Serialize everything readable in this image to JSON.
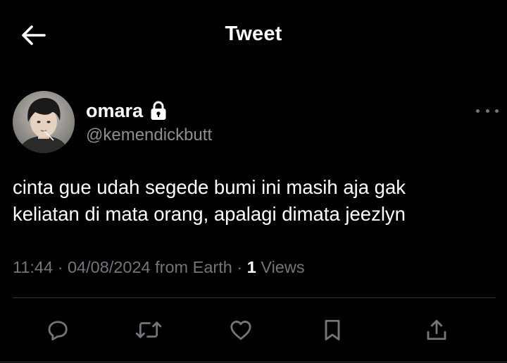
{
  "header": {
    "title": "Tweet",
    "back_icon": "arrow-left-icon"
  },
  "tweet": {
    "author": {
      "display_name": "omara",
      "handle": "@kemendickbutt",
      "protected_icon": "lock-icon"
    },
    "text_line1": "cinta gue udah segede bumi ini masih aja gak",
    "text_line2": "keliatan di mata orang, apalagi dimata jeezlyn",
    "meta": {
      "time": "11:44",
      "sep1": " · ",
      "date": "04/08/2024",
      "source": " from Earth",
      "sep2": " · ",
      "views_count": "1",
      "views_label": " Views"
    },
    "more_icon": "more-horizontal-icon"
  },
  "actions": [
    {
      "icon": "reply-icon"
    },
    {
      "icon": "retweet-icon"
    },
    {
      "icon": "heart-icon"
    },
    {
      "icon": "bookmark-icon"
    },
    {
      "icon": "share-icon"
    }
  ],
  "colors": {
    "background": "#000000",
    "text_primary": "#ffffff",
    "text_secondary": "#71767b",
    "divider": "#2f3336"
  }
}
